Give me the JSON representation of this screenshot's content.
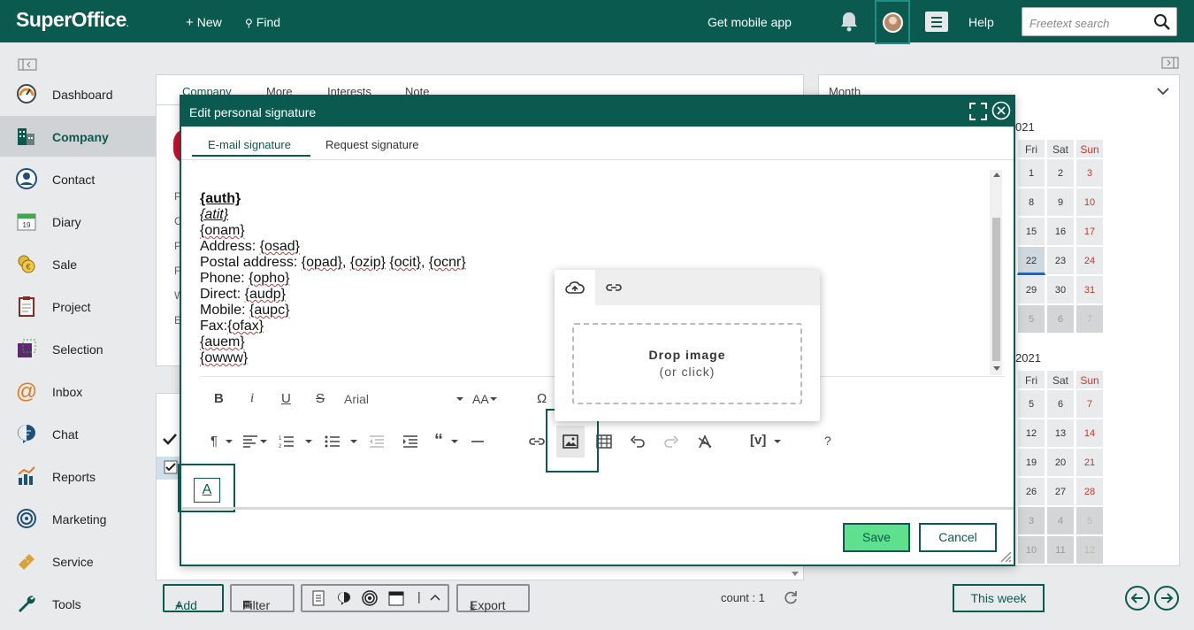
{
  "app": {
    "logo": "SuperOffice",
    "new_label": "New",
    "find_label": "Find",
    "mobile_app_label": "Get mobile app",
    "help_label": "Help",
    "search_placeholder": "Freetext search",
    "brand_color": "#0b5a4f"
  },
  "sidebar": {
    "items": [
      {
        "label": "Dashboard",
        "icon": "gauge-icon"
      },
      {
        "label": "Company",
        "icon": "buildings-icon",
        "active": true
      },
      {
        "label": "Contact",
        "icon": "person-icon"
      },
      {
        "label": "Diary",
        "icon": "calendar-icon",
        "badge": "19"
      },
      {
        "label": "Sale",
        "icon": "coins-icon"
      },
      {
        "label": "Project",
        "icon": "clipboard-icon"
      },
      {
        "label": "Selection",
        "icon": "selection-icon"
      },
      {
        "label": "Inbox",
        "icon": "at-icon"
      },
      {
        "label": "Chat",
        "icon": "chat-icon"
      },
      {
        "label": "Reports",
        "icon": "bar-chart-icon"
      },
      {
        "label": "Marketing",
        "icon": "target-icon"
      },
      {
        "label": "Service",
        "icon": "ticket-icon"
      },
      {
        "label": "Tools",
        "icon": "wrench-icon"
      }
    ]
  },
  "company_panel": {
    "tabs": [
      "Company",
      "More",
      "Interests",
      "Note"
    ],
    "active_tab": "Company",
    "field_initials": [
      "P",
      "C",
      "P",
      "F",
      "W",
      "E"
    ]
  },
  "list_panel": {
    "add_label": "Add",
    "filter_label": "Filter",
    "export_label": "Export",
    "count_label": "count : 1"
  },
  "calendar": {
    "view_label": "Month",
    "this_week_label": "This week",
    "month1_title_fragment": "021",
    "month2_title_fragment": "2021",
    "weekday_headers": [
      "Fri",
      "Sat",
      "Sun"
    ],
    "month1_rows": [
      [
        "1",
        "2",
        "3"
      ],
      [
        "8",
        "9",
        "10"
      ],
      [
        "15",
        "16",
        "17"
      ],
      [
        "22",
        "23",
        "24"
      ],
      [
        "29",
        "30",
        "31"
      ],
      [
        "5",
        "6",
        "7"
      ]
    ],
    "month2_rows": [
      [
        "5",
        "6",
        "7"
      ],
      [
        "12",
        "13",
        "14"
      ],
      [
        "19",
        "20",
        "21"
      ],
      [
        "26",
        "27",
        "28"
      ],
      [
        "3",
        "4",
        "5"
      ],
      [
        "10",
        "11",
        "12"
      ]
    ]
  },
  "modal": {
    "title": "Edit personal signature",
    "tabs": [
      "E-mail signature",
      "Request signature"
    ],
    "active_tab": "E-mail signature",
    "font_name": "Arial",
    "save_label": "Save",
    "cancel_label": "Cancel",
    "signature": {
      "auth": "{auth}",
      "atit": "{atit}",
      "onam": "{onam}",
      "address_label": "Address: ",
      "osad": "{osad}",
      "postal_label": "Postal address: ",
      "opad": "{opad}",
      "comma1": ", ",
      "ozip": "{ozip}",
      "space1": " ",
      "ocit": "{ocit}",
      "comma2": ", ",
      "ocnr": "{ocnr}",
      "phone_label": "Phone: ",
      "opho": "{opho}",
      "direct_label": "Direct: ",
      "audp": "{audp}",
      "mobile_label": "Mobile: ",
      "aupc": "{aupc}",
      "fax_label": "Fax:",
      "ofax": "{ofax}",
      "auem": "{auem}",
      "owww": "{owww}"
    },
    "toolbar_row1": [
      "B",
      "i",
      "U",
      "S",
      "AA",
      "Ω"
    ],
    "toolbar_help": "?",
    "toolbar_variable": "[v]"
  },
  "image_popup": {
    "drop_title": "Drop image",
    "drop_subtitle": "(or click)"
  }
}
